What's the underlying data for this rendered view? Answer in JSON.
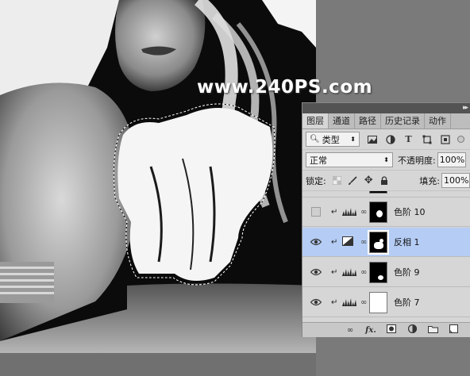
{
  "watermark": "www.240PS.com",
  "panel": {
    "tabs": [
      "图层",
      "通道",
      "路径",
      "历史记录",
      "动作"
    ],
    "active_tab": "图层",
    "filter": {
      "kind_label": "类型"
    },
    "blend": {
      "mode": "正常",
      "opacity_label": "不透明度:",
      "opacity_value": "100%"
    },
    "lock": {
      "label": "锁定:",
      "fill_label": "填充:",
      "fill_value": "100%"
    },
    "layers": [
      {
        "name": "色阶 10",
        "visible": false,
        "mask": "black-spot",
        "selected": false
      },
      {
        "name": "反相 1",
        "visible": true,
        "mask": "black-white",
        "selected": true
      },
      {
        "name": "色阶 9",
        "visible": true,
        "mask": "black-spot",
        "selected": false
      },
      {
        "name": "色阶 7",
        "visible": true,
        "mask": "white",
        "selected": false
      }
    ],
    "bottom_icons": [
      "link-icon",
      "fx-icon",
      "mask-icon",
      "adjustment-icon",
      "folder-icon",
      "new-layer-icon"
    ],
    "bottom_fx": "fx."
  },
  "colors": {
    "panel_bg": "#d6d6d6",
    "selected_row": "#b5cdf5",
    "canvas_bg": "#0c0c0c"
  }
}
